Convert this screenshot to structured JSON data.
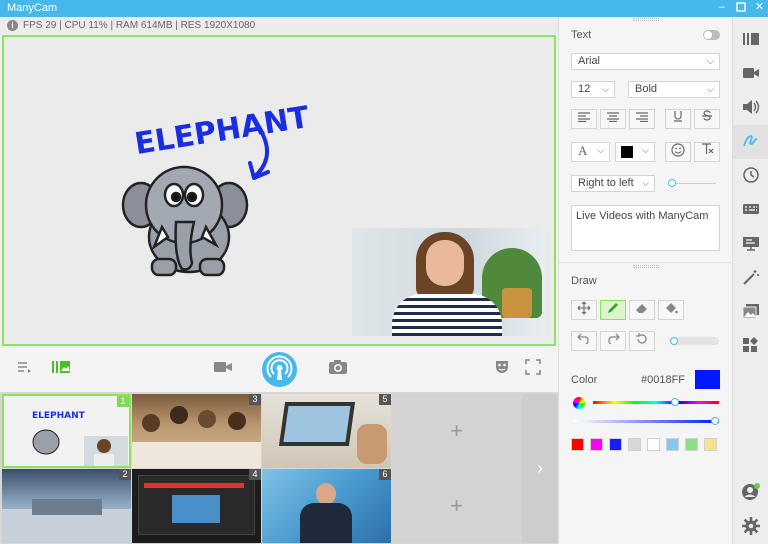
{
  "app": {
    "title": "ManyCam"
  },
  "status": {
    "info_symbol": "i",
    "stats": "FPS 29 | CPU 11% | RAM 614MB | RES 1920X1080"
  },
  "preview": {
    "drawn_text": "ELEPHANT",
    "draw_color": "#0018FF",
    "border_color": "#8EE35E"
  },
  "toolbar": {
    "icons": [
      "playlist-icon",
      "layers-icon",
      "video-camera-icon",
      "broadcast-icon",
      "snapshot-camera-icon",
      "mask-icon",
      "fullscreen-icon"
    ]
  },
  "scenes": {
    "cells": [
      {
        "num": "1",
        "selected": true
      },
      {
        "num": "3"
      },
      {
        "num": "5"
      },
      {
        "num": "2"
      },
      {
        "num": "4"
      },
      {
        "num": "6"
      }
    ],
    "thumb1_text": "ELEPHANT",
    "add_symbol": "+",
    "next_symbol": "›"
  },
  "text_panel": {
    "title": "Text",
    "font": "Arial",
    "size": "12",
    "weight": "Bold",
    "direction": "Right to left",
    "content": "Live Videos with ManyCam",
    "font_color_letter": "A",
    "font_color": "#000000"
  },
  "draw_panel": {
    "title": "Draw",
    "color_label": "Color",
    "color_hex": "#0018FF",
    "color_value": "#0018FF",
    "palette": [
      "#ff0000",
      "#ff00ff",
      "#1a1aff",
      "#d8d8d8",
      "#ffffff",
      "#87c8f0",
      "#8fdc8c",
      "#ffe08a"
    ]
  },
  "side_icons": [
    "library-icon",
    "video-icon",
    "audio-icon",
    "draw-icon",
    "clock-icon",
    "keyboard-icon",
    "presentation-icon",
    "magic-wand-icon",
    "images-icon",
    "widgets-icon",
    "account-icon",
    "settings-icon"
  ]
}
